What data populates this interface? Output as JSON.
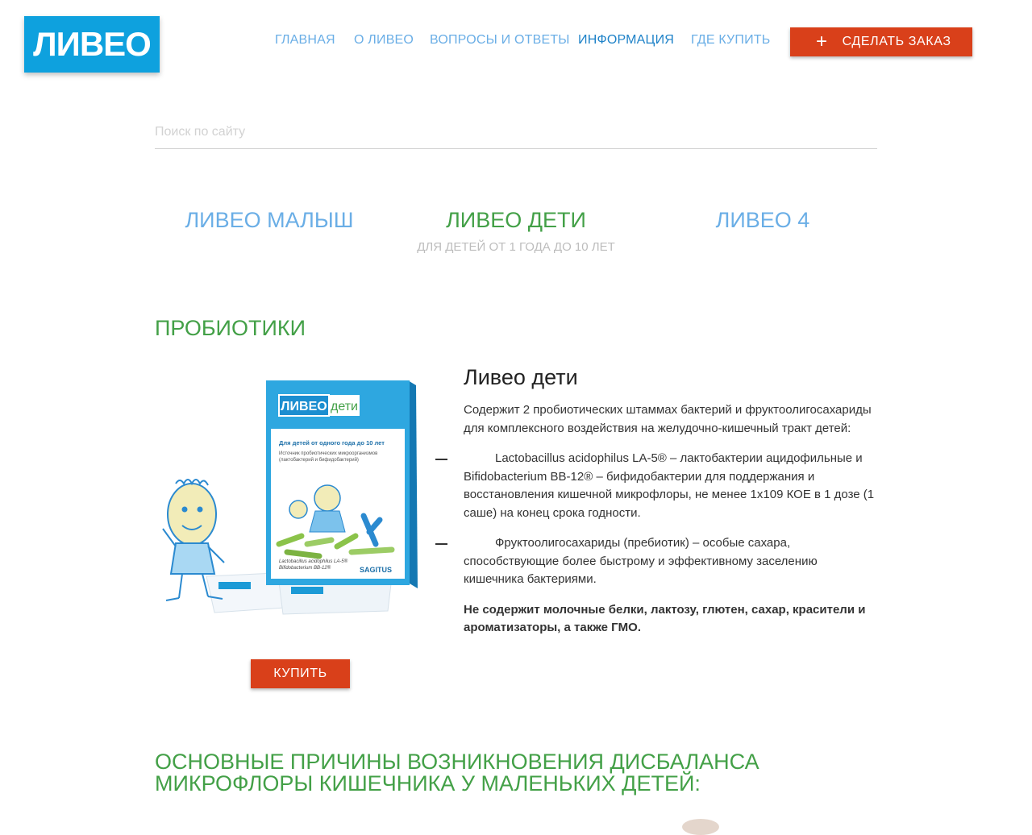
{
  "logo": "ЛИВЕО",
  "nav": [
    {
      "label": "ГЛАВНАЯ",
      "active": false
    },
    {
      "label": "О ЛИВЕО",
      "active": false
    },
    {
      "label": "ВОПРОСЫ И ОТВЕТЫ",
      "active": false
    },
    {
      "label": "ИНФОРМАЦИЯ",
      "active": true
    },
    {
      "label": "ГДЕ КУПИТЬ",
      "active": false
    }
  ],
  "order_button": {
    "icon": "plus-icon",
    "label": "СДЕЛАТЬ ЗАКАЗ"
  },
  "search": {
    "placeholder": "Поиск по сайту",
    "value": ""
  },
  "product_tabs": [
    {
      "label": "ЛИВЕО МАЛЫШ",
      "active": false
    },
    {
      "label": "ЛИВЕО ДЕТИ",
      "active": true,
      "subtitle": "ДЛЯ ДЕТЕЙ ОТ 1 ГОДА ДО 10 ЛЕТ"
    },
    {
      "label": "ЛИВЕО 4",
      "active": false
    }
  ],
  "section_title": "ПРОБИОТИКИ",
  "product": {
    "image_text": {
      "brand": "ЛИВЕО",
      "brand_suffix": "дети",
      "box_line1": "Для детей от одного года до 10 лет",
      "box_line2": "Источник пробиотических микроорганизмов",
      "box_line3": "(лактобактерий и бифидобактерий)",
      "strains": "Lactobacillus acidophilus LA-5®",
      "strains2": "Bifidobacterium BB-12®",
      "maker": "SAGITUS"
    },
    "title": "Ливео дети",
    "intro": "Содержит 2 пробиотических штаммах бактерий и фруктоолигосахариды для комплексного воздействия на желудочно-кишечный тракт детей:",
    "items": [
      "Lactobacillus acidophilus LA-5® – лактобактерии ацидофильные и Bifidobacterium BB-12® – бифидобактерии для поддержания и восстановления кишечной микрофлоры, не менее 1x109 КОЕ в 1 дозе (1 саше) на конец срока годности.",
      "Фруктоолигосахариды (пребиотик) – особые сахара, способствующие более быстрому и эффективному заселению кишечника бактериями."
    ],
    "note": "Не содержит молочные белки, лактозу, глютен, сахар, красители и ароматизаторы, а также ГМО.",
    "buy_label": "КУПИТЬ"
  },
  "causes_title": "ОСНОВНЫЕ ПРИЧИНЫ ВОЗНИКНОВЕНИЯ ДИСБАЛАНСА МИКРОФЛОРЫ КИШЕЧНИКА У МАЛЕНЬКИХ ДЕТЕЙ:",
  "colors": {
    "brand_blue": "#0ea1de",
    "accent_orange": "#d9401a",
    "green": "#43a047",
    "link_blue": "#6aaee6",
    "active_nav": "#1e82c8"
  }
}
